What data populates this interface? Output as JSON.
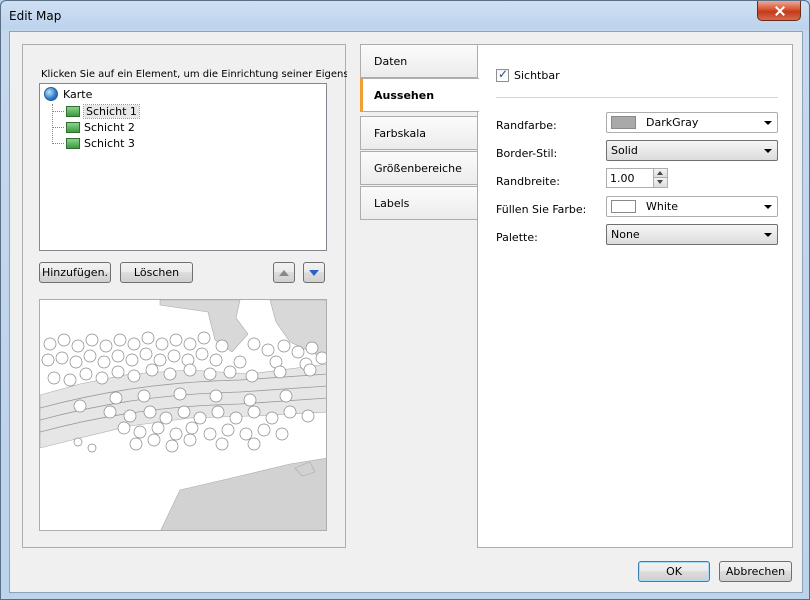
{
  "window": {
    "title": "Edit Map"
  },
  "left": {
    "hint": "Klicken Sie auf ein Element, um die Einrichtung seiner Eigenscha",
    "tree": {
      "root": "Karte",
      "children": [
        "Schicht 1",
        "Schicht 2",
        "Schicht 3"
      ],
      "selected": "Schicht 1"
    },
    "buttons": {
      "add": "Hinzufügen.",
      "delete": "Löschen"
    }
  },
  "tabs": [
    {
      "label": "Daten",
      "active": false
    },
    {
      "label": "Aussehen",
      "active": true
    },
    {
      "label": "Farbskala",
      "active": false
    },
    {
      "label": "Größenbereiche",
      "active": false
    },
    {
      "label": "Labels",
      "active": false
    }
  ],
  "properties": {
    "visible_label": "Sichtbar",
    "visible_checked": true,
    "border_color_label": "Randfarbe:",
    "border_color_value": "DarkGray",
    "border_color_hex": "#a9a9a9",
    "border_style_label": "Border-Stil:",
    "border_style_value": "Solid",
    "border_width_label": "Randbreite:",
    "border_width_value": "1.00",
    "fill_color_label": "Füllen Sie Farbe:",
    "fill_color_value": "White",
    "fill_color_hex": "#ffffff",
    "palette_label": "Palette:",
    "palette_value": "None"
  },
  "footer": {
    "ok": "OK",
    "cancel": "Abbrechen"
  }
}
